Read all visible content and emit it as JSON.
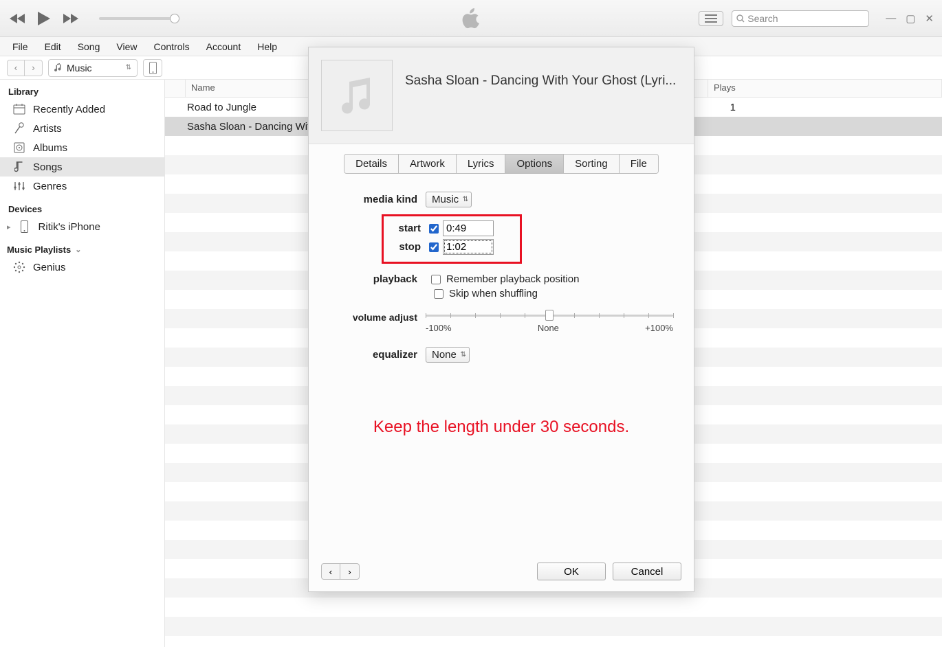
{
  "menu": [
    "File",
    "Edit",
    "Song",
    "View",
    "Controls",
    "Account",
    "Help"
  ],
  "search_placeholder": "Search",
  "library_selector": "Music",
  "sidebar": {
    "library_label": "Library",
    "items": [
      {
        "label": "Recently Added"
      },
      {
        "label": "Artists"
      },
      {
        "label": "Albums"
      },
      {
        "label": "Songs"
      },
      {
        "label": "Genres"
      }
    ],
    "devices_label": "Devices",
    "device_name": "Ritik's iPhone",
    "playlists_label": "Music Playlists",
    "genius_label": "Genius"
  },
  "columns": {
    "name": "Name",
    "plays": "Plays"
  },
  "tracks": [
    {
      "name": "Road to Jungle",
      "plays": "1"
    },
    {
      "name": "Sasha Sloan - Dancing With Your Ghost (Lyrics)",
      "plays": ""
    }
  ],
  "dialog": {
    "title": "Sasha Sloan - Dancing With Your Ghost (Lyri...",
    "tabs": [
      "Details",
      "Artwork",
      "Lyrics",
      "Options",
      "Sorting",
      "File"
    ],
    "labels": {
      "media_kind": "media kind",
      "start": "start",
      "stop": "stop",
      "playback": "playback",
      "remember": "Remember playback position",
      "skip": "Skip when shuffling",
      "volume": "volume adjust",
      "vmin": "-100%",
      "vmid": "None",
      "vmax": "+100%",
      "equalizer": "equalizer"
    },
    "media_kind_value": "Music",
    "start_value": "0:49",
    "stop_value": "1:02",
    "equalizer_value": "None",
    "annotation": "Keep the length under 30 seconds.",
    "ok": "OK",
    "cancel": "Cancel"
  }
}
